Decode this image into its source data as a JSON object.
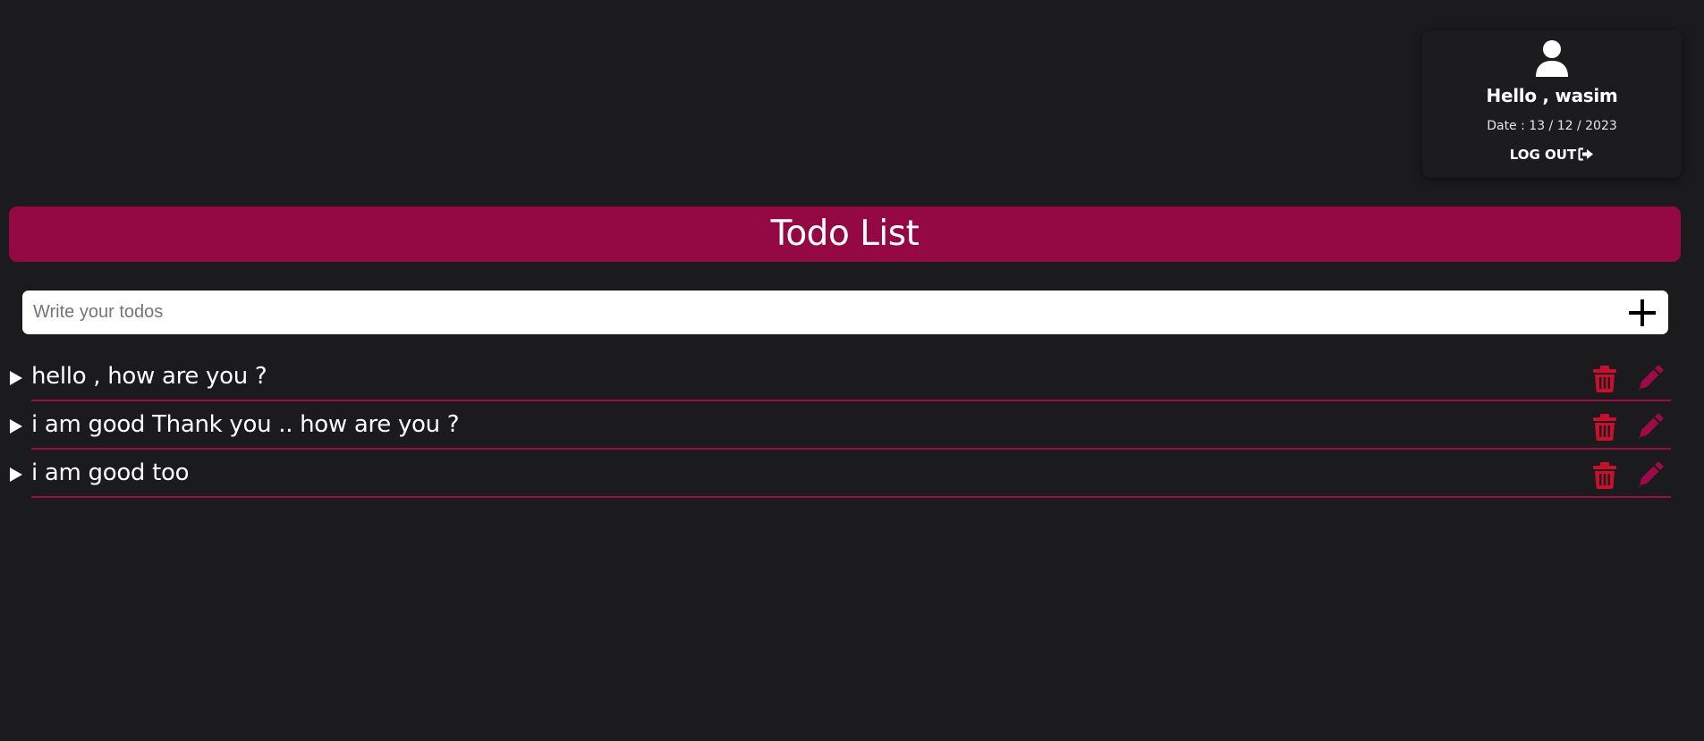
{
  "profile": {
    "greeting": "Hello , wasim",
    "date": "Date : 13 / 12 / 2023",
    "logout_label": "LOG OUT",
    "avatar_icon": "user-icon",
    "logout_icon": "sign-out-icon"
  },
  "header": {
    "title": "Todo List"
  },
  "todo_input": {
    "placeholder": "Write your todos",
    "value": "",
    "add_icon": "plus-icon"
  },
  "todos": [
    {
      "text": "hello , how are you ?"
    },
    {
      "text": "i am good Thank you .. how are you ?"
    },
    {
      "text": "i am good too"
    }
  ],
  "row_icons": {
    "expand": "caret-right-icon",
    "delete": "trash-icon",
    "edit": "pen-icon"
  },
  "colors": {
    "background": "#1b1b1d",
    "header": "#940943",
    "delete_icon": "#c8102e",
    "edit_icon": "#9c0a47",
    "divider": "#9a0c42"
  }
}
